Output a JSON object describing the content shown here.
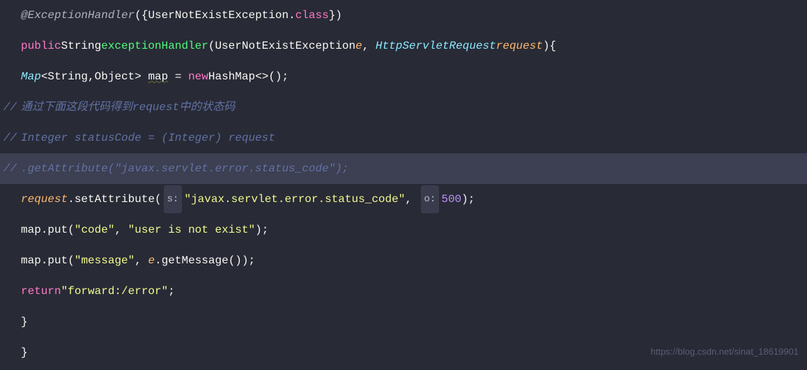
{
  "code": {
    "line1": {
      "annotation": "@ExceptionHandler",
      "paren_open": "({",
      "class_name": "UserNotExistException",
      "dot": ".",
      "class_kw": "class",
      "paren_close": "})"
    },
    "line2": {
      "public": "public",
      "string_type": "String",
      "method_name": "exceptionHandler",
      "paren_open": "(",
      "param1_type": "UserNotExistException",
      "param1_name": "e",
      "comma": ", ",
      "param2_type": "HttpServletRequest",
      "param2_name": "request",
      "paren_close": "){"
    },
    "line3": {
      "map_type": "Map",
      "generic_open": "<",
      "string_type": "String",
      "comma": ",",
      "object_type": "Object",
      "generic_close": "> ",
      "var_name": "map",
      "equals": " = ",
      "new_kw": "new",
      "hashmap": "HashMap",
      "diamond": "<>()",
      "semi": ";"
    },
    "line4": {
      "gutter": "//",
      "comment": "通过下面这段代码得到request中的状态码"
    },
    "line5": {
      "gutter": "//",
      "comment": "Integer statusCode = (Integer) request"
    },
    "line6": {
      "gutter": "//",
      "comment": ".getAttribute(\"javax.servlet.error.status_code\");"
    },
    "line7": {
      "request": "request",
      "dot": ".",
      "method": "setAttribute",
      "paren_open": "(",
      "hint_s": "s:",
      "string_val": "\"javax.servlet.error.status_code\"",
      "comma": ", ",
      "hint_o": "o:",
      "num": "500",
      "paren_close": ");"
    },
    "line8": {
      "map": "map",
      "dot": ".",
      "put": "put",
      "paren_open": "(",
      "arg1": "\"code\"",
      "comma": ", ",
      "arg2": "\"user is not exist\"",
      "paren_close": ");"
    },
    "line9": {
      "map": "map",
      "dot": ".",
      "put": "put",
      "paren_open": "(",
      "arg1": "\"message\"",
      "comma": ", ",
      "e": "e",
      "dot2": ".",
      "get_msg": "getMessage",
      "parens": "()",
      "paren_close": ");"
    },
    "line10": {
      "return_kw": "return",
      "string_val": "\"forward:/error\"",
      "semi": ";"
    },
    "line11": {
      "brace": "}"
    },
    "line12": {
      "brace": "}"
    }
  },
  "watermark": "https://blog.csdn.net/sinat_18619901"
}
